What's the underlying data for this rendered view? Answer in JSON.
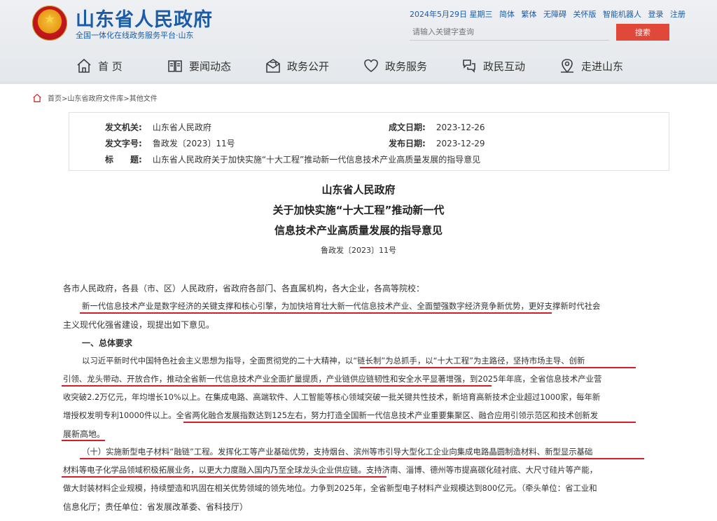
{
  "header": {
    "site_title": "山东省人民政府",
    "site_subtitle": "全国一体化在线政务服务平台·山东",
    "top_links": [
      "2024年5月29日 星期三",
      "简体",
      "繁体",
      "无障碍",
      "关怀版",
      "智能机器人",
      "登录",
      "注册"
    ],
    "search_placeholder": "请输入关键字查询",
    "search_button": "搜索"
  },
  "nav": [
    {
      "label": "首 页",
      "icon": "home-icon"
    },
    {
      "label": "要闻动态",
      "icon": "news-icon"
    },
    {
      "label": "政务公开",
      "icon": "mail-icon"
    },
    {
      "label": "政务服务",
      "icon": "heart-icon"
    },
    {
      "label": "政民互动",
      "icon": "chat-icon"
    },
    {
      "label": "走进山东",
      "icon": "map-pin-icon"
    }
  ],
  "breadcrumb": "首页>山东省政府文件库>其他文件",
  "info": {
    "issuer_label": "发文机关:",
    "issuer_value": "山东省人民政府",
    "created_label": "成文日期:",
    "created_value": "2023-12-26",
    "number_label": "发文字号:",
    "number_value": "鲁政发〔2023〕11号",
    "published_label": "发布日期:",
    "published_value": "2023-12-29",
    "title_label": "标　　题:",
    "title_value": "山东省人民政府关于加快实施“十大工程”推动新一代信息技术产业高质量发展的指导意见"
  },
  "document": {
    "title_line1": "山东省人民政府",
    "title_line2": "关于加快实施“十大工程”推动新一代",
    "title_line3": "信息技术产业高质量发展的指导意见",
    "number": "鲁政发〔2023〕11号",
    "lines": [
      "各市人民政府，各县（市、区）人民政府，省政府各部门、各直属机构，各大企业，各高等院校：",
      "新一代信息技术产业是数字经济的关键支撑和核心引擎，为加快培育壮大新一代信息技术产业、全面塑强数字经济竞争新优势，更好支撑新时代社会",
      "主义现代化强省建设，现提出如下意见。",
      "一、总体要求",
      "以习近平新时代中国特色社会主义思想为指导，全面贯彻党的二十大精神，以“链长制”为总抓手，以“十大工程”为主路径，坚持市场主导、创新",
      "引领、龙头带动、开放合作，推动全省新一代信息技术产业全面扩量提质，产业链供应链韧性和安全水平显著增强，到2025年年底，全省信息技术产业营",
      "收突破2.2万亿元，年均增长10%以上。在集成电路、高端软件、人工智能等核心领域突破一批关键共性技术，新培育高新技术企业超过1000家，每年新",
      "增授权发明专利10000件以上。全省两化融合发展指数达到125左右，努力打造全国新一代信息技术产业重要集聚区、融合应用引领示范区和技术创新发",
      "展新高地。",
      "（十）实施新型电子材料“融链”工程。发挥化工等产业基础优势，支持烟台、滨州等市引导大型化工企业向集成电路晶圆制造材料、新型显示基础",
      "材料等电子化学品领域积极拓展业务，以更大力度融入国内乃至全球龙头企业供应链。支持济南、淄博、德州等市提高碳化硅衬底、大尺寸硅片等产能，",
      "做大封装材料企业规模，持续塑造和巩固在相关优势领域的领先地位。力争到2025年，全省新型电子材料产业规模达到800亿元。（牵头单位：省工业和",
      "信息化厅；责任单位：省发展改革委、省科技厅）"
    ]
  }
}
